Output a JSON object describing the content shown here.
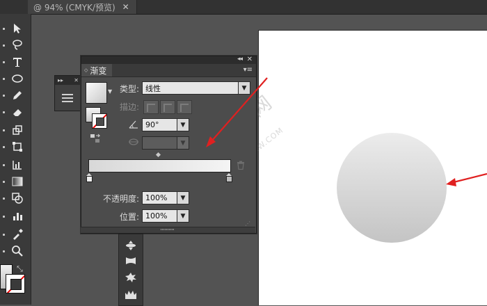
{
  "document": {
    "tab_title": "@ 94% (CMYK/预览)",
    "close_symbol": "✕"
  },
  "gradient_panel": {
    "tab_label": "渐变",
    "type_label": "类型:",
    "type_value": "线性",
    "stroke_label": "描边:",
    "angle_value": "90°",
    "opacity_label": "不透明度:",
    "opacity_value": "100%",
    "location_label": "位置:",
    "location_value": "100%",
    "gradient_start_color": "#d8d8d8",
    "gradient_end_color": "#f4f4f4"
  },
  "canvas": {
    "shape": "circle",
    "fill_top": "#ececec",
    "fill_bottom": "#c4c4c4"
  },
  "watermark": {
    "text": "软件自学网",
    "url_text": "WWW.RJZXW.COM"
  },
  "annotations": {
    "arrow_color": "#e02020"
  },
  "tools": {
    "icons": [
      "selection-icon",
      "direct-selection-icon",
      "lasso-icon",
      "type-icon",
      "ellipse-icon",
      "pencil-icon",
      "eraser-icon",
      "scale-icon",
      "free-transform-icon",
      "graph-icon",
      "gradient-icon",
      "shape-builder-icon",
      "bar-chart-icon",
      "eyedropper-icon",
      "zoom-icon"
    ]
  }
}
